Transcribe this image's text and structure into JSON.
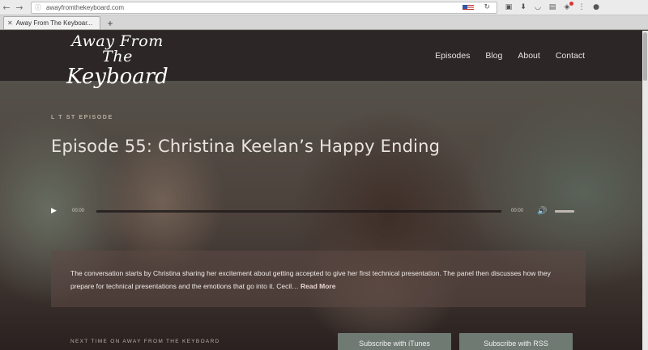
{
  "browser": {
    "url": "awayfromthekeyboard.com",
    "tab_title": "Away From The Keyboar...",
    "new_tab_label": "+",
    "tab_close_label": "✕",
    "back_glyph": "←",
    "forward_glyph": "→",
    "info_glyph": "ⓘ",
    "reload_glyph": "↻",
    "toolbar_icons": [
      "save-icon",
      "download-icon",
      "pocket-icon",
      "extension-icon",
      "addon-icon",
      "menu-dots-icon",
      "profile-icon"
    ]
  },
  "site": {
    "logo_line1": "Away From The",
    "logo_line2": "Keyboard",
    "nav": {
      "episodes": "Episodes",
      "blog": "Blog",
      "about": "About",
      "contact": "Contact"
    }
  },
  "hero": {
    "eyebrow": "L  T  ST EPISODE",
    "title": "Episode 55: Christina Keelan’s Happy Ending",
    "player": {
      "current_time": "00:00",
      "duration": "00:00",
      "progress": 0
    },
    "description": "The conversation starts by Christina sharing her excitement about getting accepted to give her first technical presentation. The panel then discusses how they prepare for technical presentations and the emotions that go into it. Cecil…",
    "read_more": "Read More"
  },
  "footer_bar": {
    "next_label": "NEXT TIME ON AWAY FROM THE KEYBOARD",
    "itunes": "Subscribe with iTunes",
    "rss": "Subscribe with RSS"
  },
  "colors": {
    "header_bg": "#2c2627",
    "subscribe_bg": "#6f7a73"
  }
}
